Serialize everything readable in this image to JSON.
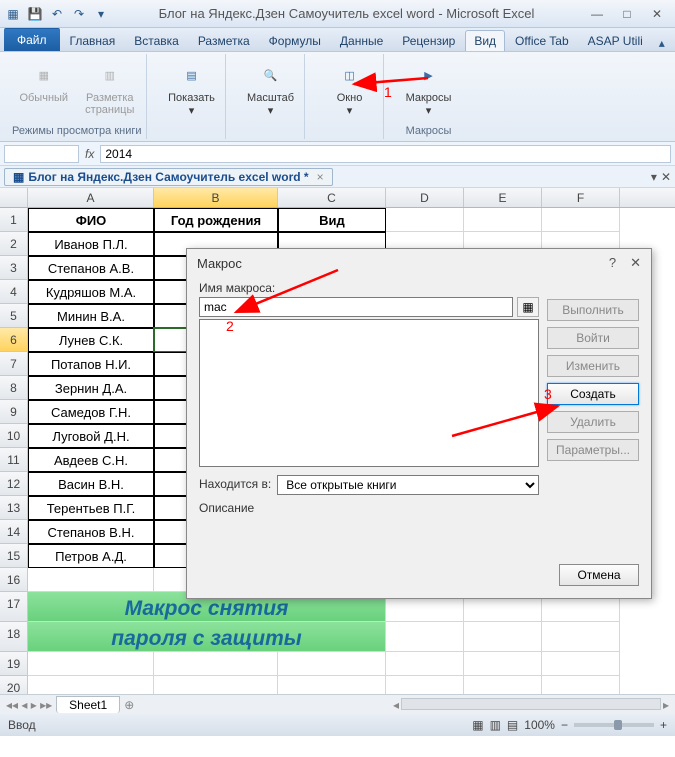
{
  "window": {
    "title": "Блог на Яндекс.Дзен Самоучитель excel word  -  Microsoft Excel",
    "min": "—",
    "max": "□",
    "close": "✕"
  },
  "qat_icons": [
    "excel-icon",
    "save-icon",
    "undo-icon",
    "redo-icon",
    "paste-icon",
    "pin-icon"
  ],
  "tabs": {
    "file": "Файл",
    "items": [
      "Главная",
      "Вставка",
      "Разметка",
      "Формулы",
      "Данные",
      "Рецензир",
      "Вид",
      "Office Tab",
      "ASAP Utili"
    ],
    "active_index": 6
  },
  "ribbon": {
    "group_workbook_views": {
      "label": "Режимы просмотра книги",
      "btn_normal": "Обычный",
      "btn_pagelayout": "Разметка\nстраницы"
    },
    "group_show": {
      "label": "",
      "btn": "Показать"
    },
    "group_zoom": {
      "label": "",
      "btn": "Масштаб"
    },
    "group_window": {
      "label": "",
      "btn": "Окно"
    },
    "group_macros": {
      "label": "Макросы",
      "btn": "Макросы"
    }
  },
  "formula_bar": {
    "fx": "fx",
    "value": "2014"
  },
  "doctab": {
    "label": "Блог на Яндекс.Дзен Самоучитель excel word *"
  },
  "columns": [
    "A",
    "B",
    "C",
    "D",
    "E",
    "F"
  ],
  "selected_col": "B",
  "selected_row": 6,
  "headers": {
    "A": "ФИО",
    "B": "Год рождения",
    "C": "Вид"
  },
  "data_rows": [
    "Иванов П.Л.",
    "Степанов А.В.",
    "Кудряшов М.А.",
    "Минин В.А.",
    "Лунев С.К.",
    "Потапов Н.И.",
    "Зернин Д.А.",
    "Самедов Г.Н.",
    "Луговой Д.Н.",
    "Авдеев С.Н.",
    "Васин В.Н.",
    "Терентьев П.Г.",
    "Степанов В.Н.",
    "Петров А.Д."
  ],
  "banner_line1": "Макрос снятия",
  "banner_line2": "пароля с защиты",
  "sheet_tab": "Sheet1",
  "statusbar": {
    "mode": "Ввод",
    "zoom": "100%"
  },
  "dialog": {
    "title": "Макрос",
    "name_label": "Имя макроса:",
    "name_value": "mac",
    "location_label": "Находится в:",
    "location_value": "Все открытые книги",
    "desc_label": "Описание",
    "btn_run": "Выполнить",
    "btn_stepinto": "Войти",
    "btn_edit": "Изменить",
    "btn_create": "Создать",
    "btn_delete": "Удалить",
    "btn_options": "Параметры...",
    "btn_cancel": "Отмена",
    "help": "?",
    "close": "✕"
  },
  "annotations": {
    "1": "1",
    "2": "2",
    "3": "3"
  }
}
